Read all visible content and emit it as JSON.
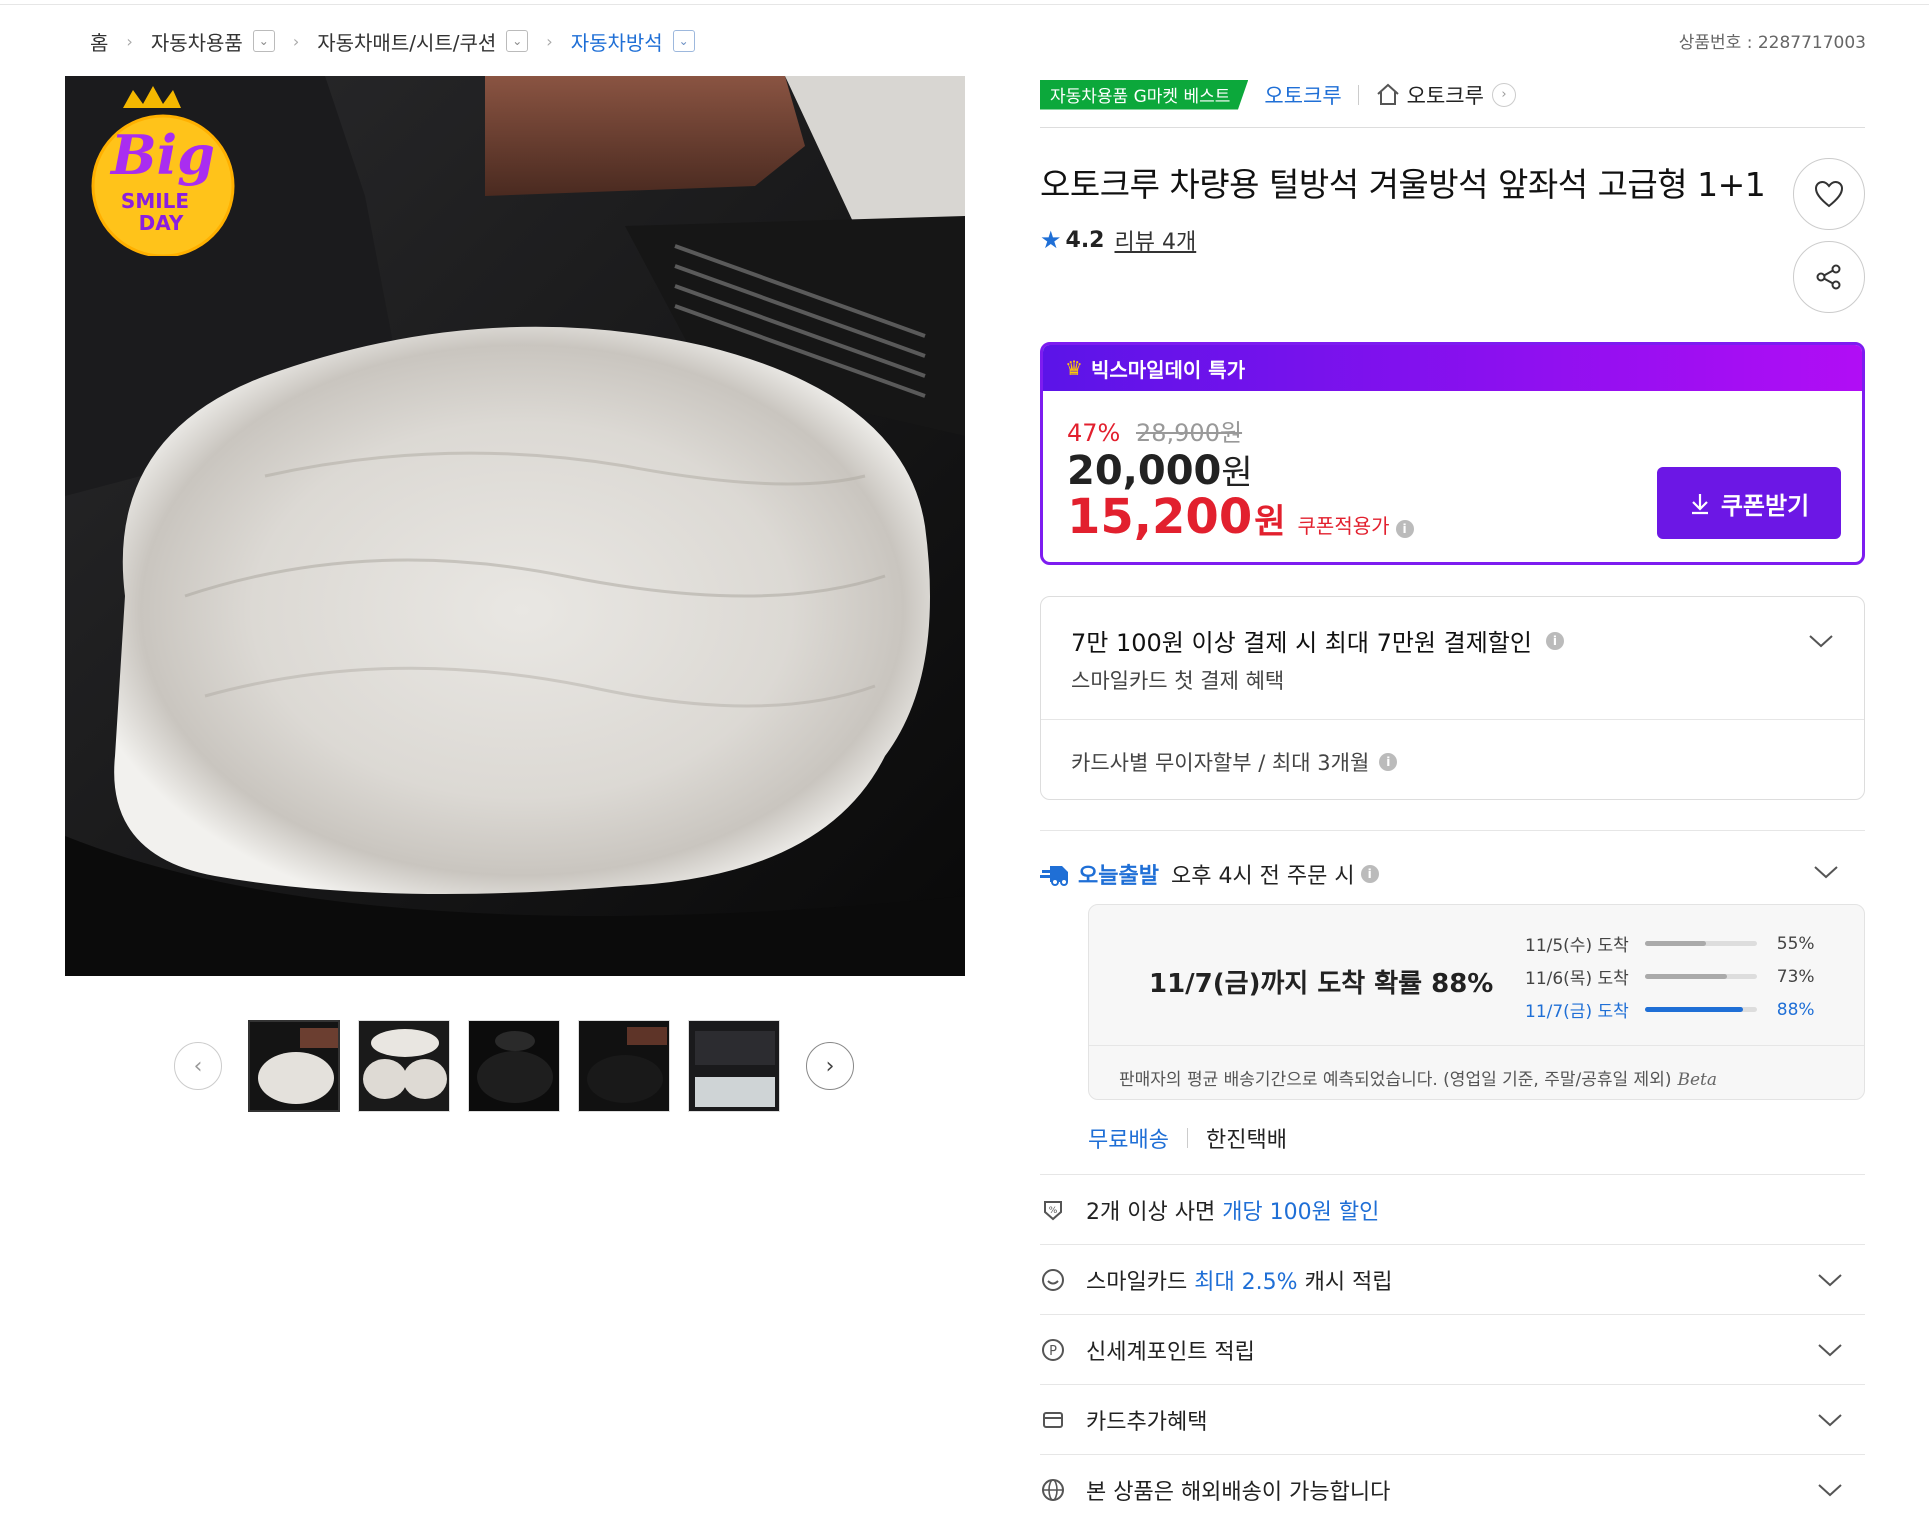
{
  "breadcrumb": {
    "home": "홈",
    "level1": "자동차용품",
    "level2": "자동차매트/시트/쿠션",
    "level3": "자동차방석"
  },
  "product_no": "상품번호 : 2287717003",
  "badge": {
    "best": "자동차용품 G마켓 베스트",
    "brand_link": "오토크루",
    "store_name": "오토크루",
    "promo_logo_text": "Big SMILE DAY"
  },
  "product": {
    "title": "오토크루 차량용 털방석 겨울방석 앞좌석 고급형 1+1",
    "rating": "4.2",
    "review": "리뷰 4개"
  },
  "price": {
    "header": "빅스마일데이 특가",
    "discount_pct": "47%",
    "original": "28,900원",
    "sale_num": "20,000",
    "sale_unit": "원",
    "coupon_num": "15,200",
    "coupon_unit": "원",
    "coupon_label": "쿠폰적용가",
    "coupon_button": "쿠폰받기"
  },
  "card_benefit": {
    "headline": "7만 100원 이상 결제 시 최대 7만원 결제할인",
    "sub": "스마일카드 첫 결제 혜택",
    "installment": "카드사별 무이자할부 / 최대 3개월"
  },
  "delivery": {
    "today_label": "오늘출발",
    "condition": "오후 4시 전 주문 시",
    "eta_main": "11/7(금)까지 도착 확률 88%",
    "rows": [
      {
        "date": "11/5(수) 도착",
        "pct_text": "55%",
        "pct": 0.55
      },
      {
        "date": "11/6(목) 도착",
        "pct_text": "73%",
        "pct": 0.73
      },
      {
        "date": "11/7(금) 도착",
        "pct_text": "88%",
        "pct": 0.88
      }
    ],
    "note": "판매자의 평균 배송기간으로 예측되었습니다. (영업일 기준, 주말/공휴일 제외)",
    "beta": "Beta",
    "free_shipping": "무료배송",
    "courier": "한진택배"
  },
  "benefits": {
    "multi_pre": "2개 이상 사면",
    "multi_hl": "개당 100원 할인",
    "smile_pre": "스마일카드",
    "smile_hl": "최대 2.5%",
    "smile_post": "캐시 적립",
    "point": "신세계포인트 적립",
    "card_extra": "카드추가혜택",
    "overseas": "본 상품은 해외배송이 가능합니다"
  },
  "colors": {
    "accent_blue": "#1f6fd6",
    "price_red": "#e2202e",
    "purple": "#6c17e5",
    "best_green": "#0ca83b"
  }
}
